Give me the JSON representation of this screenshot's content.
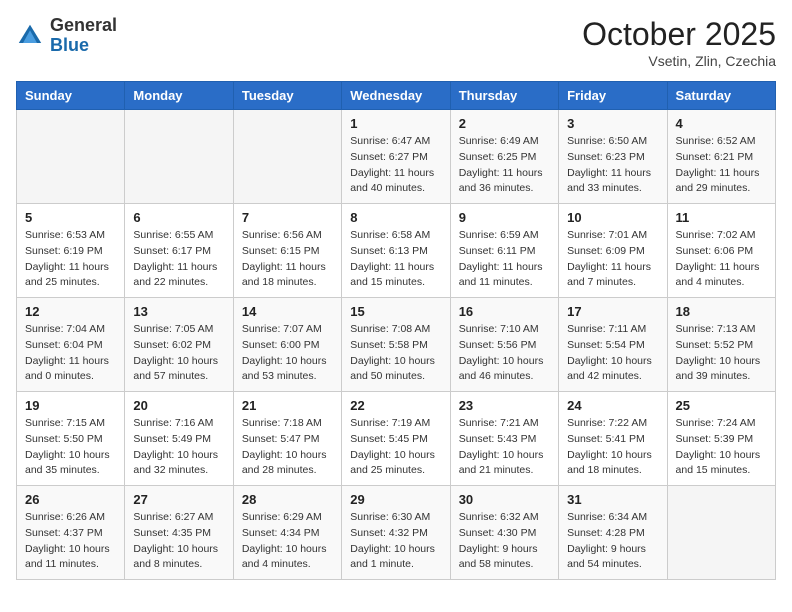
{
  "header": {
    "logo_general": "General",
    "logo_blue": "Blue",
    "month_title": "October 2025",
    "subtitle": "Vsetin, Zlin, Czechia"
  },
  "weekdays": [
    "Sunday",
    "Monday",
    "Tuesday",
    "Wednesday",
    "Thursday",
    "Friday",
    "Saturday"
  ],
  "weeks": [
    [
      {
        "day": "",
        "info": ""
      },
      {
        "day": "",
        "info": ""
      },
      {
        "day": "",
        "info": ""
      },
      {
        "day": "1",
        "info": "Sunrise: 6:47 AM\nSunset: 6:27 PM\nDaylight: 11 hours\nand 40 minutes."
      },
      {
        "day": "2",
        "info": "Sunrise: 6:49 AM\nSunset: 6:25 PM\nDaylight: 11 hours\nand 36 minutes."
      },
      {
        "day": "3",
        "info": "Sunrise: 6:50 AM\nSunset: 6:23 PM\nDaylight: 11 hours\nand 33 minutes."
      },
      {
        "day": "4",
        "info": "Sunrise: 6:52 AM\nSunset: 6:21 PM\nDaylight: 11 hours\nand 29 minutes."
      }
    ],
    [
      {
        "day": "5",
        "info": "Sunrise: 6:53 AM\nSunset: 6:19 PM\nDaylight: 11 hours\nand 25 minutes."
      },
      {
        "day": "6",
        "info": "Sunrise: 6:55 AM\nSunset: 6:17 PM\nDaylight: 11 hours\nand 22 minutes."
      },
      {
        "day": "7",
        "info": "Sunrise: 6:56 AM\nSunset: 6:15 PM\nDaylight: 11 hours\nand 18 minutes."
      },
      {
        "day": "8",
        "info": "Sunrise: 6:58 AM\nSunset: 6:13 PM\nDaylight: 11 hours\nand 15 minutes."
      },
      {
        "day": "9",
        "info": "Sunrise: 6:59 AM\nSunset: 6:11 PM\nDaylight: 11 hours\nand 11 minutes."
      },
      {
        "day": "10",
        "info": "Sunrise: 7:01 AM\nSunset: 6:09 PM\nDaylight: 11 hours\nand 7 minutes."
      },
      {
        "day": "11",
        "info": "Sunrise: 7:02 AM\nSunset: 6:06 PM\nDaylight: 11 hours\nand 4 minutes."
      }
    ],
    [
      {
        "day": "12",
        "info": "Sunrise: 7:04 AM\nSunset: 6:04 PM\nDaylight: 11 hours\nand 0 minutes."
      },
      {
        "day": "13",
        "info": "Sunrise: 7:05 AM\nSunset: 6:02 PM\nDaylight: 10 hours\nand 57 minutes."
      },
      {
        "day": "14",
        "info": "Sunrise: 7:07 AM\nSunset: 6:00 PM\nDaylight: 10 hours\nand 53 minutes."
      },
      {
        "day": "15",
        "info": "Sunrise: 7:08 AM\nSunset: 5:58 PM\nDaylight: 10 hours\nand 50 minutes."
      },
      {
        "day": "16",
        "info": "Sunrise: 7:10 AM\nSunset: 5:56 PM\nDaylight: 10 hours\nand 46 minutes."
      },
      {
        "day": "17",
        "info": "Sunrise: 7:11 AM\nSunset: 5:54 PM\nDaylight: 10 hours\nand 42 minutes."
      },
      {
        "day": "18",
        "info": "Sunrise: 7:13 AM\nSunset: 5:52 PM\nDaylight: 10 hours\nand 39 minutes."
      }
    ],
    [
      {
        "day": "19",
        "info": "Sunrise: 7:15 AM\nSunset: 5:50 PM\nDaylight: 10 hours\nand 35 minutes."
      },
      {
        "day": "20",
        "info": "Sunrise: 7:16 AM\nSunset: 5:49 PM\nDaylight: 10 hours\nand 32 minutes."
      },
      {
        "day": "21",
        "info": "Sunrise: 7:18 AM\nSunset: 5:47 PM\nDaylight: 10 hours\nand 28 minutes."
      },
      {
        "day": "22",
        "info": "Sunrise: 7:19 AM\nSunset: 5:45 PM\nDaylight: 10 hours\nand 25 minutes."
      },
      {
        "day": "23",
        "info": "Sunrise: 7:21 AM\nSunset: 5:43 PM\nDaylight: 10 hours\nand 21 minutes."
      },
      {
        "day": "24",
        "info": "Sunrise: 7:22 AM\nSunset: 5:41 PM\nDaylight: 10 hours\nand 18 minutes."
      },
      {
        "day": "25",
        "info": "Sunrise: 7:24 AM\nSunset: 5:39 PM\nDaylight: 10 hours\nand 15 minutes."
      }
    ],
    [
      {
        "day": "26",
        "info": "Sunrise: 6:26 AM\nSunset: 4:37 PM\nDaylight: 10 hours\nand 11 minutes."
      },
      {
        "day": "27",
        "info": "Sunrise: 6:27 AM\nSunset: 4:35 PM\nDaylight: 10 hours\nand 8 minutes."
      },
      {
        "day": "28",
        "info": "Sunrise: 6:29 AM\nSunset: 4:34 PM\nDaylight: 10 hours\nand 4 minutes."
      },
      {
        "day": "29",
        "info": "Sunrise: 6:30 AM\nSunset: 4:32 PM\nDaylight: 10 hours\nand 1 minute."
      },
      {
        "day": "30",
        "info": "Sunrise: 6:32 AM\nSunset: 4:30 PM\nDaylight: 9 hours\nand 58 minutes."
      },
      {
        "day": "31",
        "info": "Sunrise: 6:34 AM\nSunset: 4:28 PM\nDaylight: 9 hours\nand 54 minutes."
      },
      {
        "day": "",
        "info": ""
      }
    ]
  ]
}
